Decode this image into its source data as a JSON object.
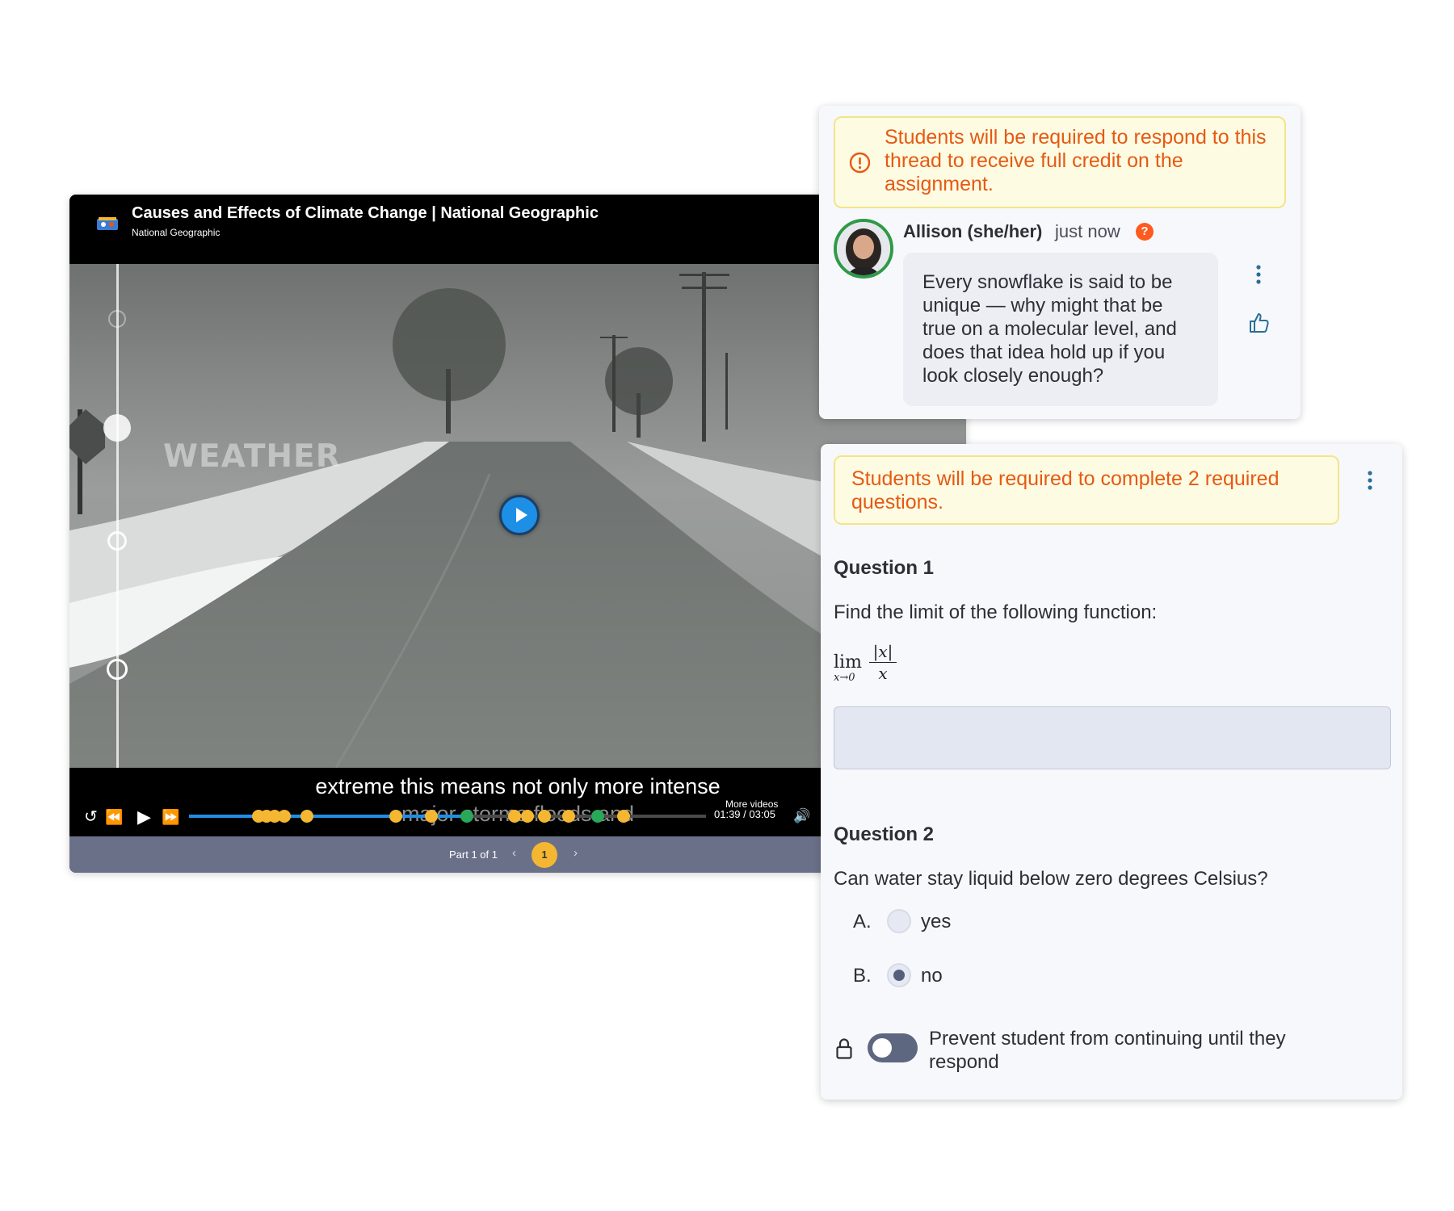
{
  "video": {
    "title": "Causes and Effects of Climate Change | National Geographic",
    "channel": "National Geographic",
    "overlay_text": "WEATHER",
    "caption_line1": "extreme this means not only more intense",
    "caption_line2": "major storms floods and",
    "current_time": "01:39",
    "duration": "03:05",
    "time_separator": "/",
    "more_videos": "More videos",
    "progress_fraction": 0.54,
    "accent_color": "#1e8fe6",
    "marker_colors": {
      "question": "#f5b731",
      "discussion": "#29a85a"
    },
    "part_label": "Part 1 of 1",
    "page": "1",
    "icons": {
      "replay": "↺",
      "rewind": "⏪",
      "play": "▶",
      "forward": "⏩",
      "volume": "🔊",
      "prev": "‹",
      "next": "›"
    }
  },
  "thread": {
    "notice": "Students will be required to respond to this thread to receive full credit on the assignment.",
    "author": "Allison (she/her)",
    "timestamp": "just now",
    "badge": "?",
    "message": "Every snowflake is said to be unique — why might that be true on a molecular level, and does that idea hold up if you look closely enough?"
  },
  "questions": {
    "notice": "Students will be required to complete 2 required questions.",
    "q1": {
      "title": "Question 1",
      "prompt": "Find the limit of the following function:",
      "math_op": "lim",
      "math_sub": "x→0",
      "math_num": "|x|",
      "math_den": "x",
      "answer_value": ""
    },
    "q2": {
      "title": "Question 2",
      "prompt": "Can water stay liquid below zero degrees Celsius?",
      "options": [
        {
          "letter": "A.",
          "label": "yes",
          "selected": false
        },
        {
          "letter": "B.",
          "label": "no",
          "selected": true
        }
      ]
    },
    "prevent_toggle_label": "Prevent student from continuing until they respond",
    "prevent_toggle_on": false
  }
}
